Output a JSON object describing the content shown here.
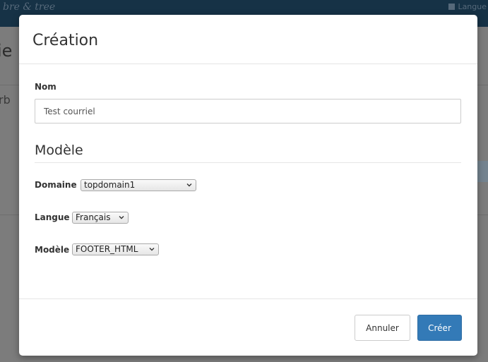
{
  "background": {
    "brand": "bre & tree",
    "language_link": "Langue",
    "title_fragment": "ie",
    "label_fragment": "rb"
  },
  "modal": {
    "title": "Création",
    "nom_label": "Nom",
    "nom_value": "Test courriel",
    "modele_heading": "Modèle",
    "domaine_label": "Domaine",
    "domaine_value": "topdomain1",
    "langue_label": "Langue",
    "langue_value": "Français",
    "modele_label": "Modèle",
    "modele_value": "FOOTER_HTML",
    "cancel_label": "Annuler",
    "create_label": "Créer"
  },
  "colors": {
    "navbar": "#163246",
    "overlay": "#7c7c7c",
    "primary_button": "#337ab7"
  },
  "icons": {
    "flag": "flag-icon",
    "dropdown": "chevron-down-icon"
  }
}
